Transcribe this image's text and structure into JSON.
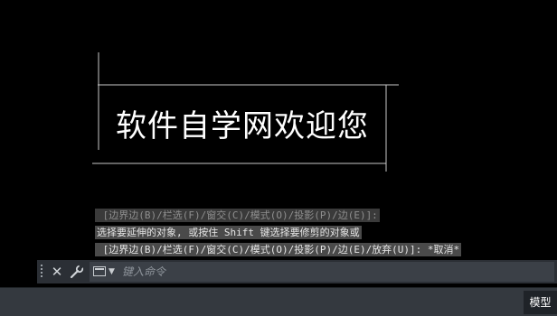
{
  "drawing": {
    "text": "软件自学网欢迎您"
  },
  "command_history": {
    "line1": " [边界边(B)/栏选(F)/窗交(C)/模式(O)/投影(P)/边(E)]:",
    "line2": "选择要延伸的对象, 或按住 Shift 键选择要修剪的对象或",
    "line3": " [边界边(B)/栏选(F)/窗交(C)/模式(O)/投影(P)/边(E)/放弃(U)]: *取消*"
  },
  "command_bar": {
    "close_icon": "close-icon",
    "customize_icon": "wrench-icon",
    "prompt_icon": "command-prompt-icon",
    "placeholder": "键入命令"
  },
  "status_bar": {
    "model_tab": "模型"
  },
  "colors": {
    "canvas": "#000000",
    "drawing_lines": "#c8c8c8",
    "command_bar": "#2b2f35",
    "status_bar": "#34393f"
  }
}
